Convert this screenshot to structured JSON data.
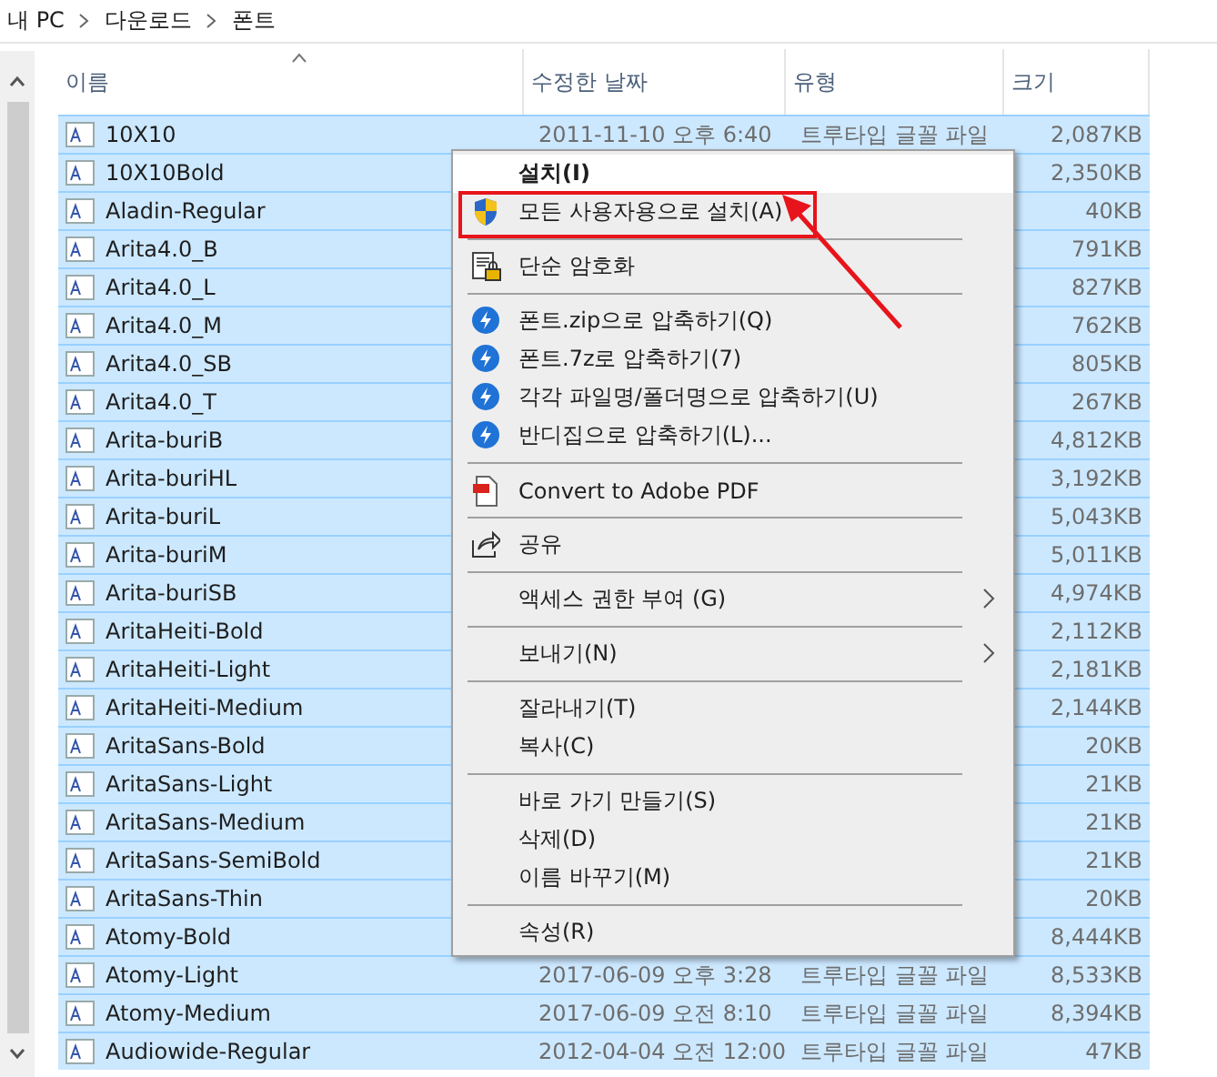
{
  "breadcrumb": [
    "내 PC",
    "다운로드",
    "폰트"
  ],
  "columns": [
    {
      "label": "이름",
      "sorted": true
    },
    {
      "label": "수정한 날짜",
      "sorted": false
    },
    {
      "label": "유형",
      "sorted": false
    },
    {
      "label": "크기",
      "sorted": false
    }
  ],
  "rows": [
    {
      "name": "10X10",
      "date": "2011-11-10 오후 6:40",
      "type": "트루타입 글꼴 파일",
      "size": "2,087KB",
      "selected": true
    },
    {
      "name": "10X10Bold",
      "size": "2,350KB",
      "selected": true
    },
    {
      "name": "Aladin-Regular",
      "size": "40KB",
      "selected": true
    },
    {
      "name": "Arita4.0_B",
      "size": "791KB",
      "selected": true
    },
    {
      "name": "Arita4.0_L",
      "size": "827KB",
      "selected": true
    },
    {
      "name": "Arita4.0_M",
      "size": "762KB",
      "selected": true
    },
    {
      "name": "Arita4.0_SB",
      "size": "805KB",
      "selected": true
    },
    {
      "name": "Arita4.0_T",
      "size": "267KB",
      "selected": true
    },
    {
      "name": "Arita-buriB",
      "size": "4,812KB",
      "selected": true
    },
    {
      "name": "Arita-buriHL",
      "size": "3,192KB",
      "selected": true
    },
    {
      "name": "Arita-buriL",
      "size": "5,043KB",
      "selected": true
    },
    {
      "name": "Arita-buriM",
      "size": "5,011KB",
      "selected": true
    },
    {
      "name": "Arita-buriSB",
      "size": "4,974KB",
      "selected": true
    },
    {
      "name": "AritaHeiti-Bold",
      "size": "2,112KB",
      "selected": true
    },
    {
      "name": "AritaHeiti-Light",
      "size": "2,181KB",
      "selected": true
    },
    {
      "name": "AritaHeiti-Medium",
      "size": "2,144KB",
      "selected": true
    },
    {
      "name": "AritaSans-Bold",
      "size": "20KB",
      "selected": true
    },
    {
      "name": "AritaSans-Light",
      "size": "21KB",
      "selected": true
    },
    {
      "name": "AritaSans-Medium",
      "size": "21KB",
      "selected": true
    },
    {
      "name": "AritaSans-SemiBold",
      "size": "21KB",
      "selected": true
    },
    {
      "name": "AritaSans-Thin",
      "size": "20KB",
      "selected": true
    },
    {
      "name": "Atomy-Bold",
      "size": "8,444KB",
      "selected": true
    },
    {
      "name": "Atomy-Light",
      "date": "2017-06-09 오후 3:28",
      "type": "트루타입 글꼴 파일",
      "size": "8,533KB",
      "selected": true
    },
    {
      "name": "Atomy-Medium",
      "date": "2017-06-09 오전 8:10",
      "type": "트루타입 글꼴 파일",
      "size": "8,394KB",
      "selected": true
    },
    {
      "name": "Audiowide-Regular",
      "date": "2012-04-04 오전 12:00",
      "type": "트루타입 글꼴 파일",
      "size": "47KB",
      "selected": true
    }
  ],
  "context_menu": [
    {
      "kind": "plain",
      "label": "설치(I)",
      "bold": true,
      "hover": true,
      "annotated": false,
      "submenu": false
    },
    {
      "kind": "shield",
      "label": "모든 사용자용으로 설치(A)",
      "bold": false,
      "hover": false,
      "annotated": true,
      "submenu": false
    },
    {
      "kind": "separator"
    },
    {
      "kind": "encrypt",
      "label": "단순 암호화",
      "bold": false,
      "hover": false,
      "annotated": false,
      "submenu": false
    },
    {
      "kind": "separator"
    },
    {
      "kind": "archive",
      "label": "폰트.zip으로 압축하기(Q)",
      "bold": false,
      "hover": false,
      "annotated": false,
      "submenu": false
    },
    {
      "kind": "archive",
      "label": "폰트.7z로 압축하기(7)",
      "bold": false,
      "hover": false,
      "annotated": false,
      "submenu": false
    },
    {
      "kind": "archive",
      "label": "각각 파일명/폴더명으로 압축하기(U)",
      "bold": false,
      "hover": false,
      "annotated": false,
      "submenu": false
    },
    {
      "kind": "archive",
      "label": "반디집으로 압축하기(L)...",
      "bold": false,
      "hover": false,
      "annotated": false,
      "submenu": false
    },
    {
      "kind": "separator"
    },
    {
      "kind": "pdf",
      "label": "Convert to Adobe PDF",
      "bold": false,
      "hover": false,
      "annotated": false,
      "submenu": false
    },
    {
      "kind": "separator"
    },
    {
      "kind": "share",
      "label": "공유",
      "bold": false,
      "hover": false,
      "annotated": false,
      "submenu": false
    },
    {
      "kind": "separator"
    },
    {
      "kind": "plain",
      "label": "액세스 권한 부여 (G)",
      "bold": false,
      "hover": false,
      "annotated": false,
      "submenu": true
    },
    {
      "kind": "separator"
    },
    {
      "kind": "plain",
      "label": "보내기(N)",
      "bold": false,
      "hover": false,
      "annotated": false,
      "submenu": true
    },
    {
      "kind": "separator"
    },
    {
      "kind": "plain",
      "label": "잘라내기(T)",
      "bold": false,
      "hover": false,
      "annotated": false,
      "submenu": false
    },
    {
      "kind": "plain",
      "label": "복사(C)",
      "bold": false,
      "hover": false,
      "annotated": false,
      "submenu": false
    },
    {
      "kind": "separator"
    },
    {
      "kind": "plain",
      "label": "바로 가기 만들기(S)",
      "bold": false,
      "hover": false,
      "annotated": false,
      "submenu": false
    },
    {
      "kind": "plain",
      "label": "삭제(D)",
      "bold": false,
      "hover": false,
      "annotated": false,
      "submenu": false
    },
    {
      "kind": "plain",
      "label": "이름 바꾸기(M)",
      "bold": false,
      "hover": false,
      "annotated": false,
      "submenu": false
    },
    {
      "kind": "separator"
    },
    {
      "kind": "plain",
      "label": "속성(R)",
      "bold": false,
      "hover": false,
      "annotated": false,
      "submenu": false
    }
  ]
}
